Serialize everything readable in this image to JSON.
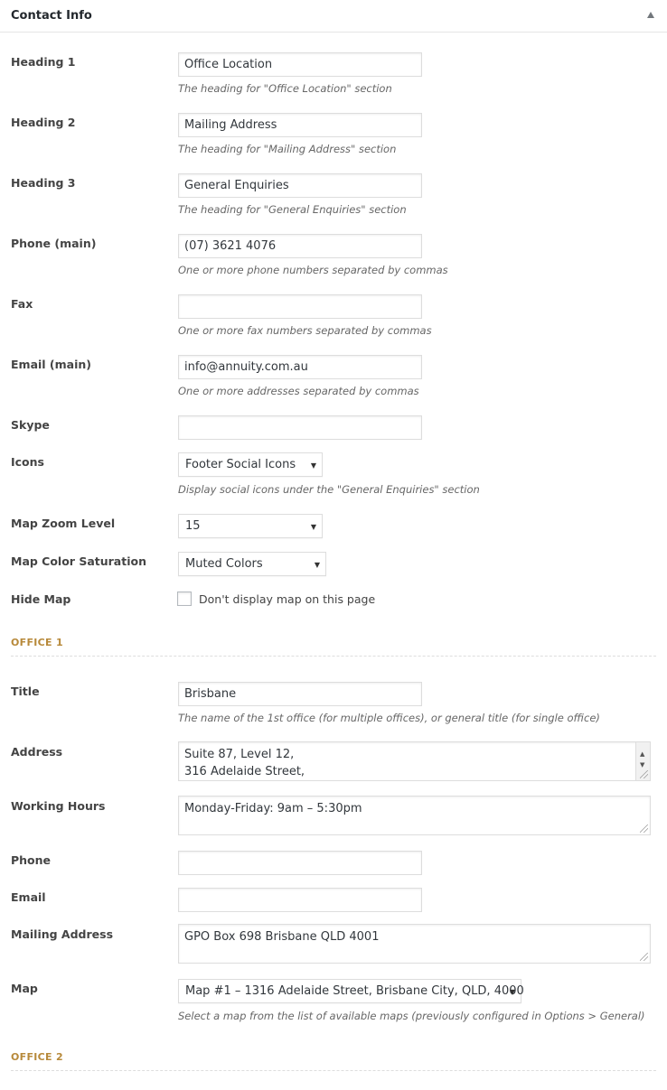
{
  "panel": {
    "title": "Contact Info"
  },
  "fields": {
    "heading1": {
      "label": "Heading 1",
      "value": "Office Location",
      "desc": "The heading for \"Office Location\" section"
    },
    "heading2": {
      "label": "Heading 2",
      "value": "Mailing Address",
      "desc": "The heading for \"Mailing Address\" section"
    },
    "heading3": {
      "label": "Heading 3",
      "value": "General Enquiries",
      "desc": "The heading for \"General Enquiries\" section"
    },
    "phone_main": {
      "label": "Phone (main)",
      "value": "(07) 3621 4076",
      "desc": "One or more phone numbers separated by commas"
    },
    "fax": {
      "label": "Fax",
      "value": "",
      "desc": "One or more fax numbers separated by commas"
    },
    "email_main": {
      "label": "Email (main)",
      "value": "info@annuity.com.au",
      "desc": "One or more addresses separated by commas"
    },
    "skype": {
      "label": "Skype",
      "value": ""
    },
    "icons": {
      "label": "Icons",
      "value": "Footer Social Icons",
      "desc": "Display social icons under the \"General Enquiries\" section"
    },
    "map_zoom": {
      "label": "Map Zoom Level",
      "value": "15"
    },
    "map_saturation": {
      "label": "Map Color Saturation",
      "value": "Muted Colors"
    },
    "hide_map": {
      "label": "Hide Map",
      "checkbox_label": "Don't display map on this page",
      "checked": false
    }
  },
  "office1": {
    "section": "OFFICE 1",
    "title": {
      "label": "Title",
      "value": "Brisbane",
      "desc": "The name of the 1st office (for multiple offices), or general title (for single office)"
    },
    "address": {
      "label": "Address",
      "line1": "Suite 87, Level 12,",
      "line2": "316 Adelaide Street,"
    },
    "hours": {
      "label": "Working Hours",
      "value": "Monday-Friday: 9am – 5:30pm"
    },
    "phone": {
      "label": "Phone",
      "value": ""
    },
    "email": {
      "label": "Email",
      "value": ""
    },
    "mailing": {
      "label": "Mailing Address",
      "value": "GPO Box 698 Brisbane QLD 4001"
    },
    "map": {
      "label": "Map",
      "value": "Map #1 – 1316 Adelaide Street, Brisbane City, QLD, 4000",
      "desc": "Select a map from the list of available maps (previously configured in Options > General)"
    }
  },
  "office2": {
    "section": "OFFICE 2"
  }
}
